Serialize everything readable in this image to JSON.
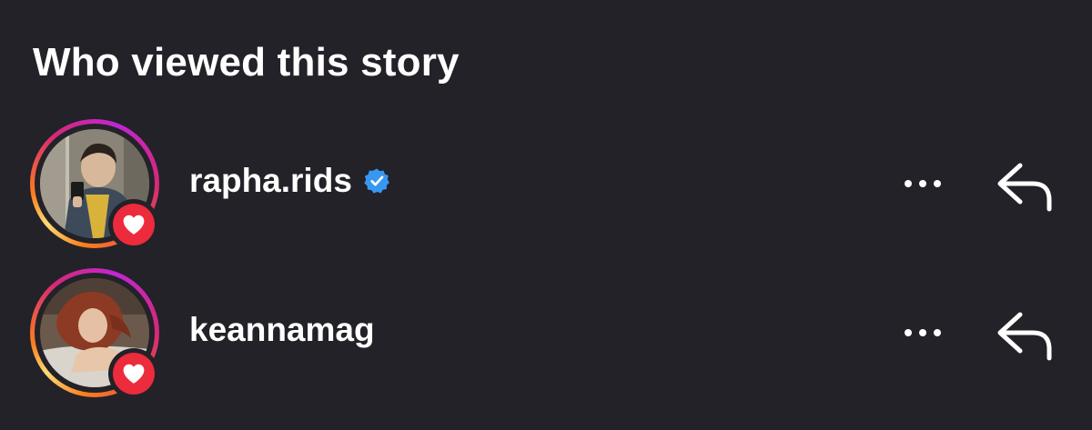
{
  "header": {
    "title": "Who viewed this story"
  },
  "viewers": [
    {
      "username": "rapha.rids",
      "verified": true,
      "liked": true,
      "avatar_icon": "profile-photo",
      "more_icon": "more-dots-icon",
      "reply_icon": "reply-arrow-icon"
    },
    {
      "username": "keannamag",
      "verified": false,
      "liked": true,
      "avatar_icon": "profile-photo",
      "more_icon": "more-dots-icon",
      "reply_icon": "reply-arrow-icon"
    }
  ],
  "colors": {
    "background": "#222228",
    "like_badge": "#ec2b3c",
    "verified_badge": "#3897f0",
    "text": "#ffffff",
    "story_ring_start": "#c026d3",
    "story_ring_end": "#feda75"
  }
}
